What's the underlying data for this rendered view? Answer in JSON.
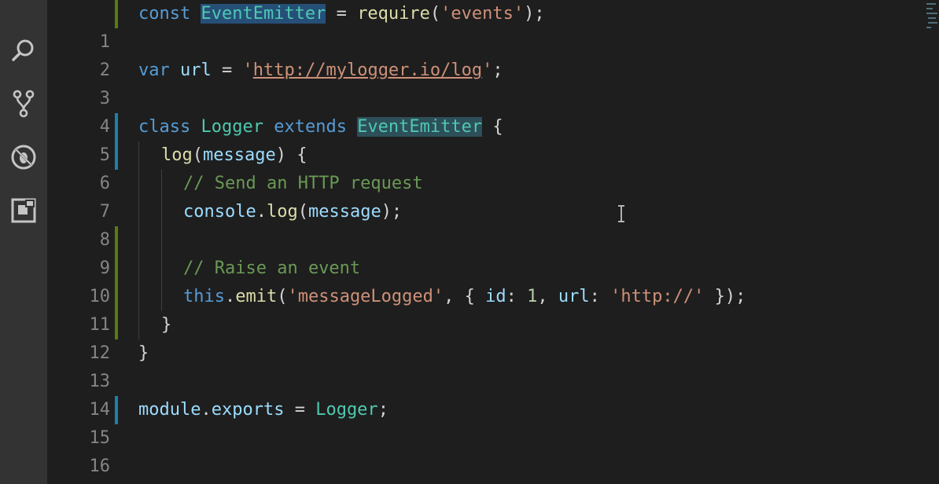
{
  "activity_bar": {
    "icons": [
      "search-icon",
      "source-control-icon",
      "debug-icon",
      "extensions-icon"
    ]
  },
  "editor": {
    "language": "javascript",
    "lines": [
      {
        "n": "1"
      },
      {
        "n": "2"
      },
      {
        "n": "3"
      },
      {
        "n": "4"
      },
      {
        "n": "5"
      },
      {
        "n": "6"
      },
      {
        "n": "7"
      },
      {
        "n": "8"
      },
      {
        "n": "9"
      },
      {
        "n": "10"
      },
      {
        "n": "11"
      },
      {
        "n": "12"
      },
      {
        "n": "13"
      },
      {
        "n": "14"
      },
      {
        "n": "15"
      },
      {
        "n": "16"
      }
    ],
    "tokens": {
      "l1": {
        "kw": "const",
        "cls": "EventEmitter",
        "eq": " = ",
        "fn": "require",
        "open": "(",
        "str": "'events'",
        "close": ");"
      },
      "l3": {
        "kw": "var",
        "var": "url",
        "eq": " = ",
        "q1": "'",
        "url": "http://mylogger.io/log",
        "q2": "'",
        "end": ";"
      },
      "l5": {
        "kw1": "class",
        "cls1": "Logger",
        "kw2": "extends",
        "cls2": "EventEmitter",
        "brace": " {"
      },
      "l6": {
        "fn": "log",
        "open": "(",
        "var": "message",
        "close": ") {"
      },
      "l7": {
        "cmt": "// Send an HTTP request"
      },
      "l8": {
        "var1": "console",
        "dot": ".",
        "fn": "log",
        "open": "(",
        "var2": "message",
        "close": ");"
      },
      "l10": {
        "cmt": "// Raise an event"
      },
      "l11": {
        "kw": "this",
        "dot": ".",
        "fn": "emit",
        "open": "(",
        "str1": "'messageLogged'",
        "sep": ", { ",
        "key1": "id",
        "colon1": ": ",
        "num": "1",
        "comma": ", ",
        "key2": "url",
        "colon2": ": ",
        "str2": "'http://'",
        "close": " });"
      },
      "l12": {
        "brace": "}"
      },
      "l13": {
        "brace": "}"
      },
      "l15": {
        "var1": "module",
        "dot": ".",
        "var2": "exports",
        "eq": " = ",
        "cls": "Logger",
        "end": ";"
      }
    }
  },
  "colors": {
    "activity_bar": "#333333",
    "editor_bg": "#1e1e1e",
    "git_modified": "#1b81a8",
    "git_added": "#587c0c"
  }
}
